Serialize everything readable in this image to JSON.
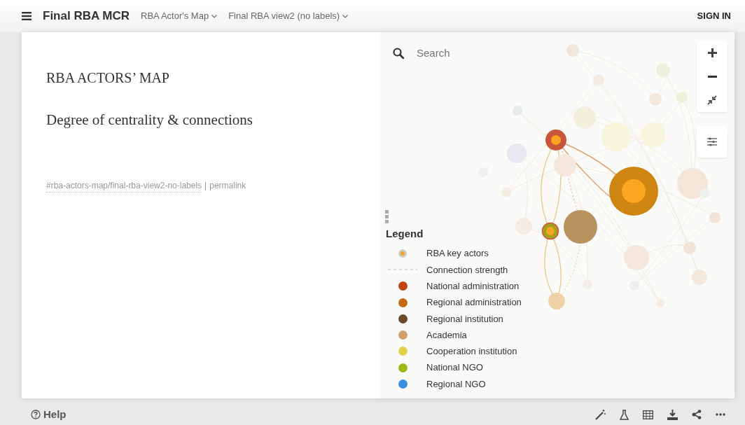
{
  "header": {
    "title": "Final RBA MCR",
    "menus": [
      "RBA Actor's Map",
      "Final RBA view2 (no labels)"
    ],
    "sign_in": "SIGN IN"
  },
  "story": {
    "title": "RBA ACTORS’ MAP",
    "subtitle": "Degree of centrality & connections",
    "link": "#rba-actors-map/final-rba-view2-no-labels",
    "separator": "|",
    "permalink": "permalink"
  },
  "search": {
    "placeholder": "Search"
  },
  "legend": {
    "title": "Legend",
    "items": [
      {
        "kind": "actor",
        "label": "RBA key actors"
      },
      {
        "kind": "line",
        "label": "Connection strength"
      },
      {
        "kind": "category",
        "label": "National administration",
        "color": "#c1440e"
      },
      {
        "kind": "category",
        "label": "Regional administration",
        "color": "#c46a12"
      },
      {
        "kind": "category",
        "label": "Regional institution",
        "color": "#6b4a2b"
      },
      {
        "kind": "category",
        "label": "Academia",
        "color": "#d1a06a"
      },
      {
        "kind": "category",
        "label": "Cooperation institution",
        "color": "#e2d24a"
      },
      {
        "kind": "category",
        "label": "National NGO",
        "color": "#a3b618"
      },
      {
        "kind": "category",
        "label": "Regional NGO",
        "color": "#3b8fe0"
      }
    ]
  },
  "footer": {
    "help": "Help"
  }
}
